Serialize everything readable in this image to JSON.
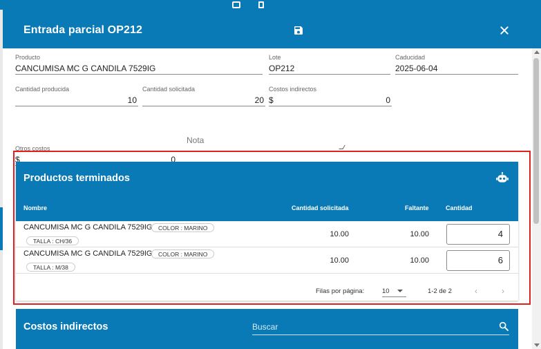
{
  "dialog": {
    "title": "Entrada parcial OP212",
    "save_icon": "save-icon",
    "close_icon": "close-icon"
  },
  "form": {
    "producto": {
      "label": "Producto",
      "value": "CANCUMISA MC G CANDILA 7529IG"
    },
    "lote": {
      "label": "Lote",
      "value": "OP212"
    },
    "caducidad": {
      "label": "Caducidad",
      "value": "2025-06-04"
    },
    "cantidad_producida": {
      "label": "Cantidad producida",
      "value": "10"
    },
    "cantidad_solicitada": {
      "label": "Cantidad solicitada",
      "value": "20"
    },
    "costos_indirectos": {
      "label": "Costos indirectos",
      "currency": "$",
      "value": "0"
    },
    "otros_costos": {
      "label": "Otros costos",
      "currency": "$",
      "value": "0"
    },
    "nota": {
      "placeholder": "Nota",
      "value": ""
    }
  },
  "productos_terminados": {
    "title": "Productos terminados",
    "robot_icon": "robot-icon",
    "columns": [
      "Nombre",
      "Cantidad solicitada",
      "Faltante",
      "Cantidad"
    ],
    "rows": [
      {
        "name": "CANCUMISA MC G CANDILA 7529IG",
        "chip1": "COLOR : MARINO",
        "chip2": "TALLA : CH/36",
        "solicitada": "10.00",
        "faltante": "10.00",
        "cantidad": "4"
      },
      {
        "name": "CANCUMISA MC G CANDILA 7529IG",
        "chip1": "COLOR : MARINO",
        "chip2": "TALLA : M/38",
        "solicitada": "10.00",
        "faltante": "10.00",
        "cantidad": "6"
      }
    ],
    "pagination": {
      "label": "Filas por página:",
      "rows_per_page": "10",
      "range": "1-2 de 2",
      "prev": "‹",
      "next": "›"
    }
  },
  "costos_indirectos_section": {
    "title": "Costos indirectos",
    "search_placeholder": "Buscar",
    "search_icon": "search-icon"
  },
  "colors": {
    "primary": "#0a7ab7",
    "highlight": "#e0201f"
  }
}
